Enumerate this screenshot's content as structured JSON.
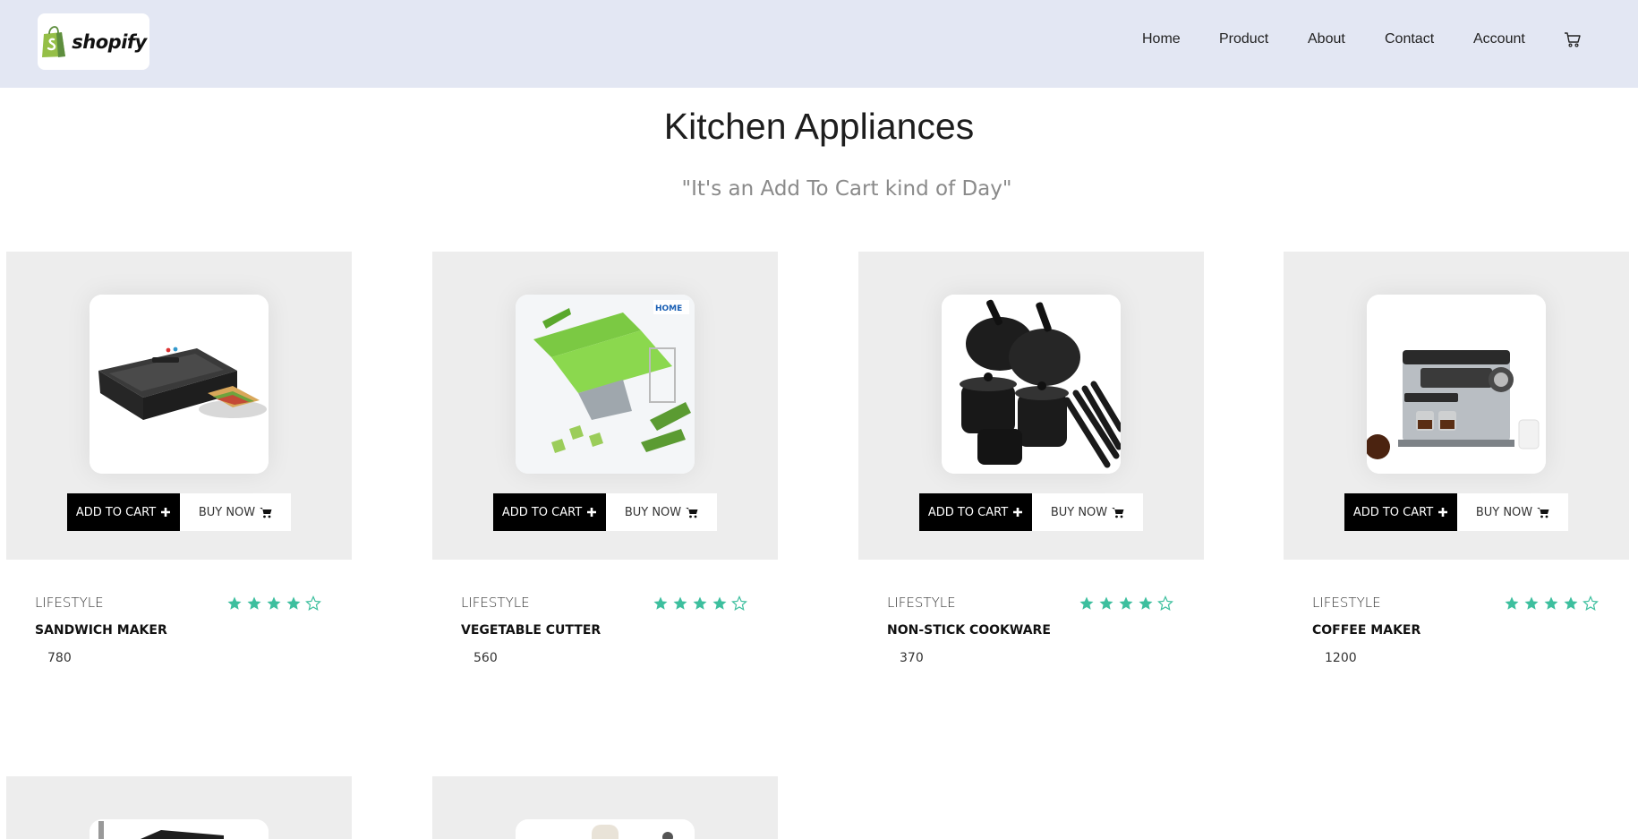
{
  "header": {
    "logo_text": "shopify",
    "nav": [
      {
        "label": "Home"
      },
      {
        "label": "Product"
      },
      {
        "label": "About"
      },
      {
        "label": "Contact"
      },
      {
        "label": "Account"
      }
    ],
    "cart_icon": "shopping-cart-icon"
  },
  "main": {
    "title": "Kitchen Appliances",
    "tagline": "\"It's an Add To Cart kind of Day\""
  },
  "buttons": {
    "add_to_cart": "ADD TO CART",
    "buy_now": "BUY NOW"
  },
  "products": [
    {
      "category": "LIFESTYLE",
      "name": "SANDWICH MAKER",
      "price": "780",
      "rating": 4,
      "rating_max": 5
    },
    {
      "category": "LIFESTYLE",
      "name": "VEGETABLE CUTTER",
      "price": "560",
      "rating": 4,
      "rating_max": 5
    },
    {
      "category": "LIFESTYLE",
      "name": "NON-STICK COOKWARE",
      "price": "370",
      "rating": 4,
      "rating_max": 5
    },
    {
      "category": "LIFESTYLE",
      "name": "COFFEE MAKER",
      "price": "1200",
      "rating": 4,
      "rating_max": 5
    }
  ],
  "colors": {
    "header_bg": "#e3e7f3",
    "card_bg": "#ededed",
    "star": "#3dbf9e",
    "button_dark": "#000000"
  }
}
